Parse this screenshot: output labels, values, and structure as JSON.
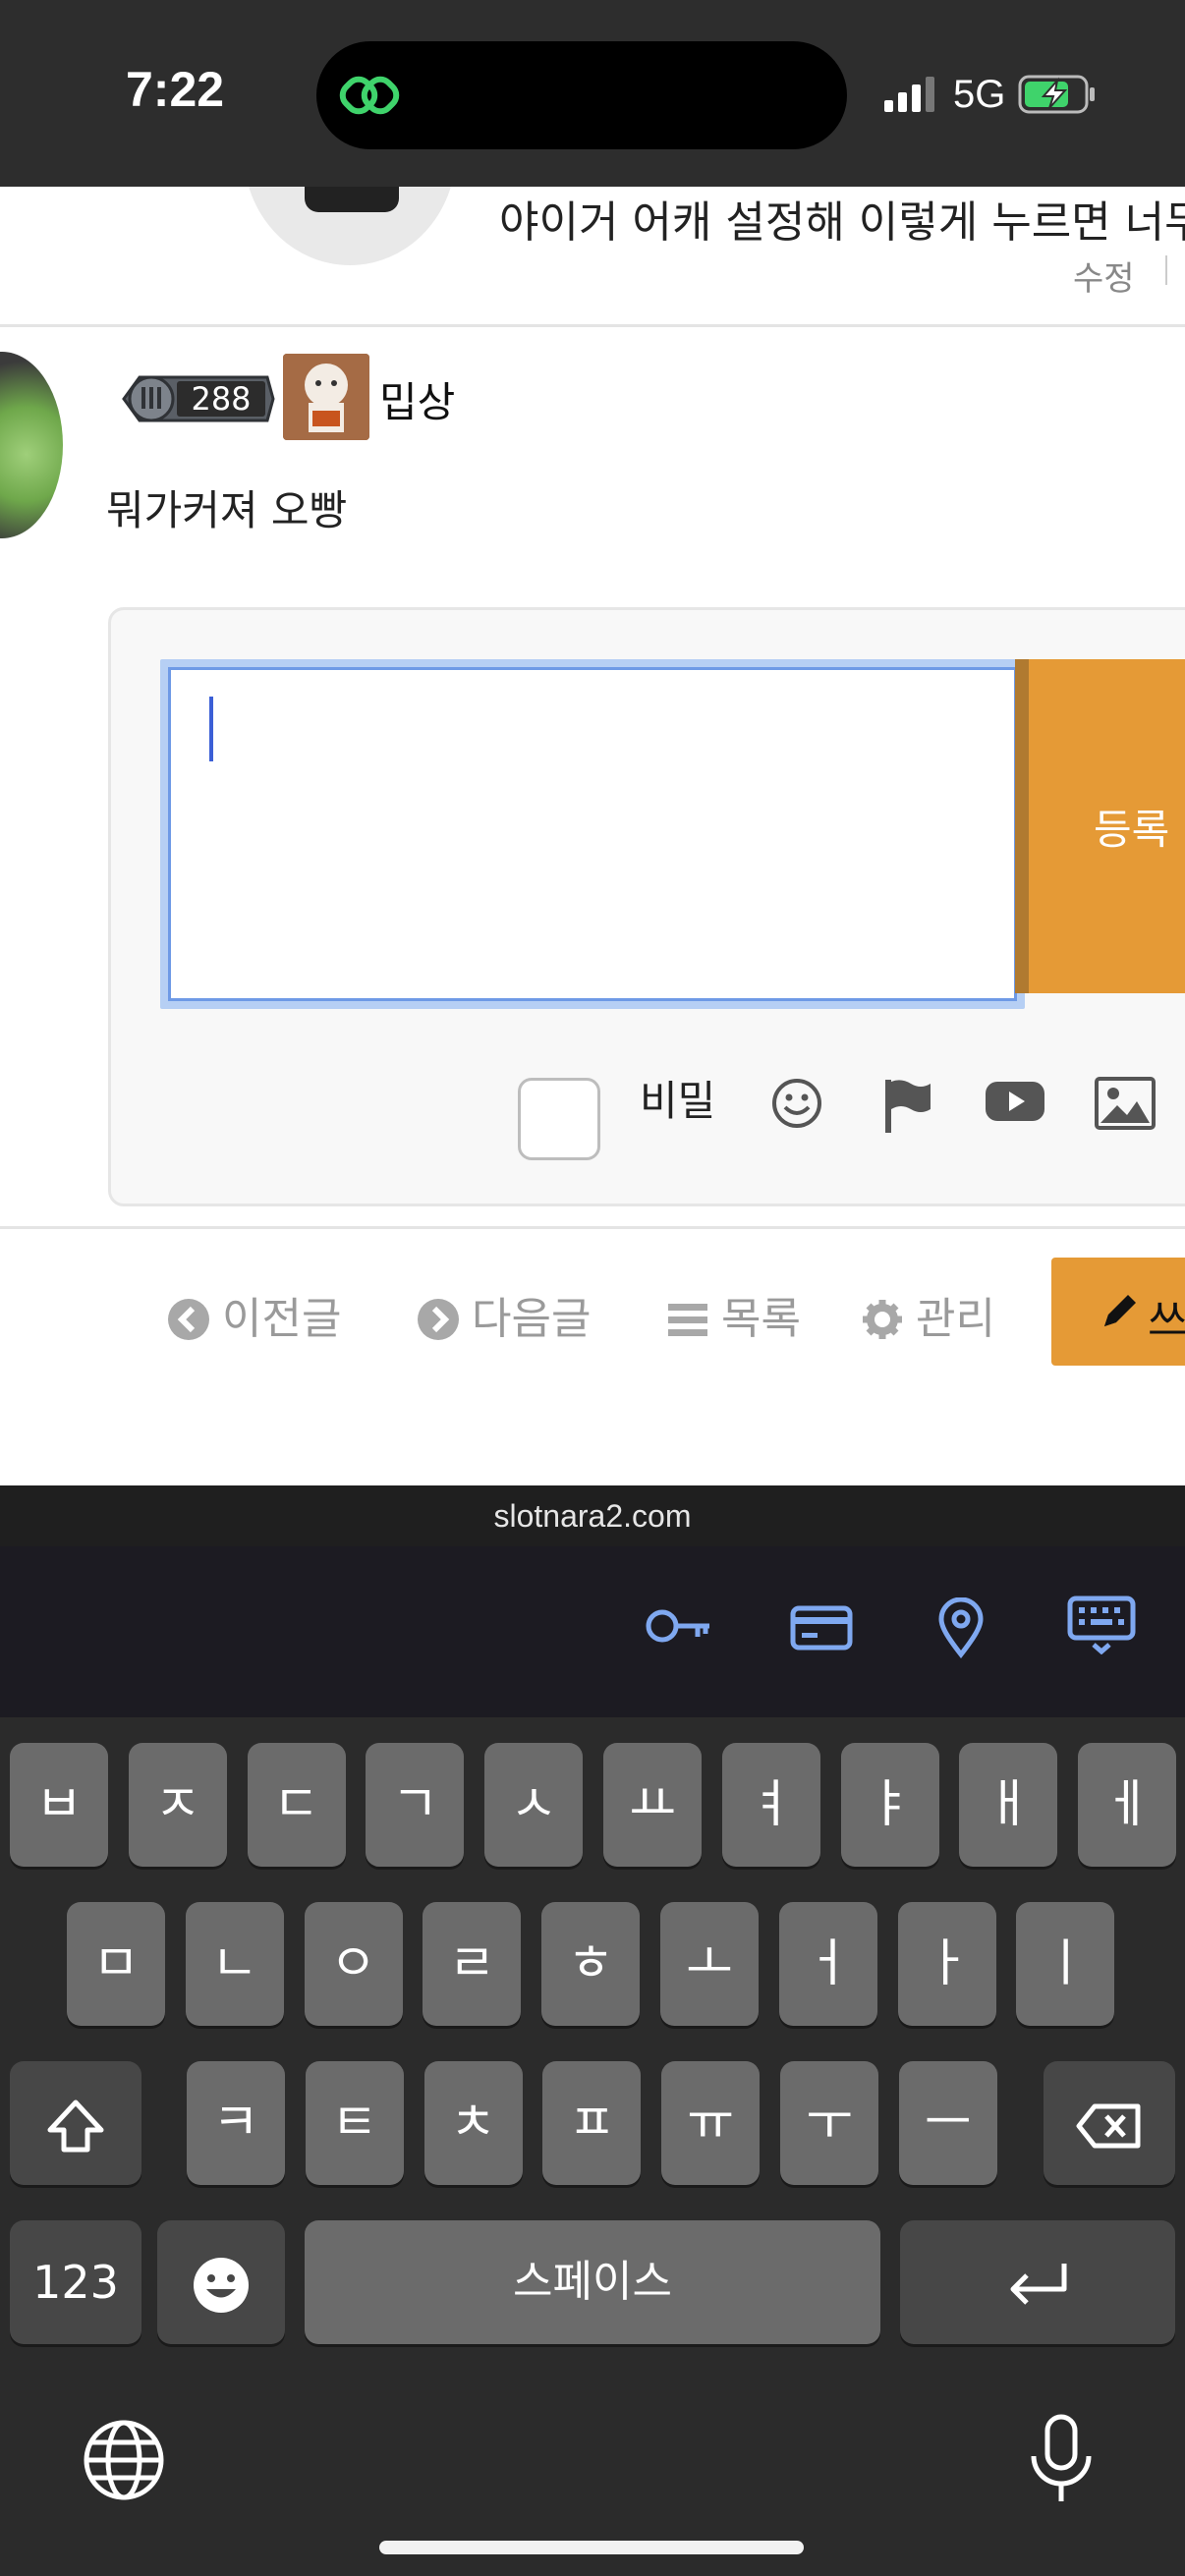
{
  "status": {
    "time": "7:22",
    "network": "5G"
  },
  "page": {
    "top_comment_text": "야이거 어캐 설정해 이렇게 누르면 너무",
    "edit_label": "수정",
    "comment": {
      "level": "288",
      "nickname": "밉상",
      "text": "뭐가커져 오빵"
    },
    "reply": {
      "submit_label": "등록",
      "secret_label": "비밀"
    },
    "nav": {
      "prev": "이전글",
      "next": "다음글",
      "list": "목록",
      "manage": "관리",
      "write": "쓰"
    }
  },
  "browser": {
    "url": "slotnara2.com"
  },
  "keyboard": {
    "row1": [
      "ㅂ",
      "ㅈ",
      "ㄷ",
      "ㄱ",
      "ㅅ",
      "ㅛ",
      "ㅕ",
      "ㅑ",
      "ㅐ",
      "ㅔ"
    ],
    "row2": [
      "ㅁ",
      "ㄴ",
      "ㅇ",
      "ㄹ",
      "ㅎ",
      "ㅗ",
      "ㅓ",
      "ㅏ",
      "ㅣ"
    ],
    "row3": [
      "ㅋ",
      "ㅌ",
      "ㅊ",
      "ㅍ",
      "ㅠ",
      "ㅜ",
      "ㅡ"
    ],
    "numbers_label": "123",
    "space_label": "스페이스"
  },
  "colors": {
    "accent": "#e59a36",
    "link_icon": "#7fa8f0"
  }
}
